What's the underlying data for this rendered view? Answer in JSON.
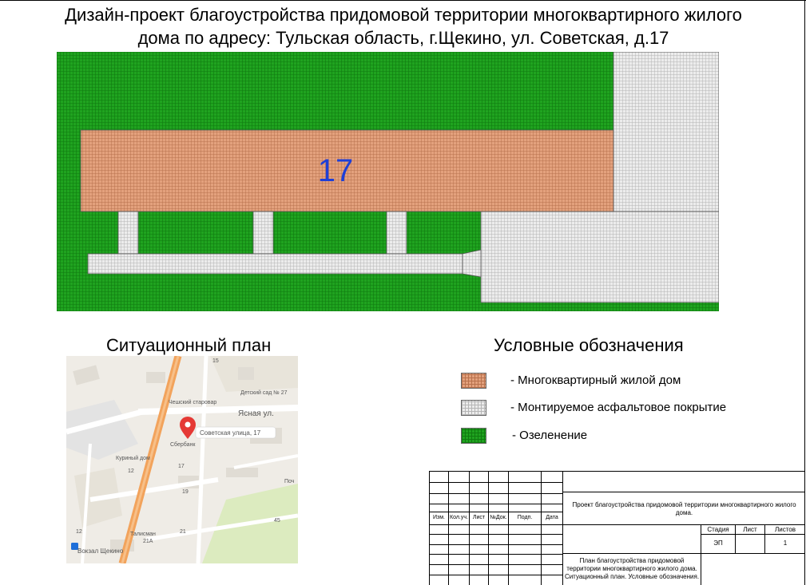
{
  "header": {
    "title_line1": "Дизайн-проект благоустройства придомовой территории многоквартирного жилого",
    "title_line2": "дома по адресу: Тульская область, г.Щекино, ул. Советская, д.17"
  },
  "plan": {
    "building_number": "17",
    "colors": {
      "green": "#1fa31f",
      "building": "#e3a17d",
      "asphalt": "#e7e7e7",
      "building_number": "#1f3fd6"
    }
  },
  "situation_plan": {
    "title": "Ситуационный план",
    "map_labels": {
      "street": "Ясная ул.",
      "address": "Советская улица, 17",
      "kindergarten": "Детский сад № 27",
      "shop": "Чешский старовар",
      "bank": "Сбербанк",
      "house_shop": "Куриный дом",
      "talisman": "Талисман",
      "station": "Вокзал Щекино",
      "post": "Поч",
      "n19": "19",
      "n15": "15",
      "n17": "17",
      "n12": "12",
      "n21": "21",
      "n21a": "21А",
      "n45": "45",
      "n12b": "12"
    }
  },
  "legend": {
    "title": "Условные обозначения",
    "items": [
      {
        "label": "- Многоквартирный жилой дом"
      },
      {
        "label": "- Монтируемое асфальтовое покрытие"
      },
      {
        "label": "- Озеленение"
      }
    ]
  },
  "stamp": {
    "headers": [
      "Изм.",
      "Кол.уч.",
      "Лист",
      "№Док.",
      "Подп.",
      "Дата"
    ],
    "project_name": "Проект благоустройства придомовой территории многоквартирного жилого дома.",
    "stage_label": "Стадия",
    "sheet_label": "Лист",
    "sheets_label": "Листов",
    "stage_value": "ЭП",
    "sheets_value": "1",
    "sheet_title": "План благоустройства придомовой территории многоквартирного жилого дома. Ситуационный план. Условные обозначения."
  }
}
